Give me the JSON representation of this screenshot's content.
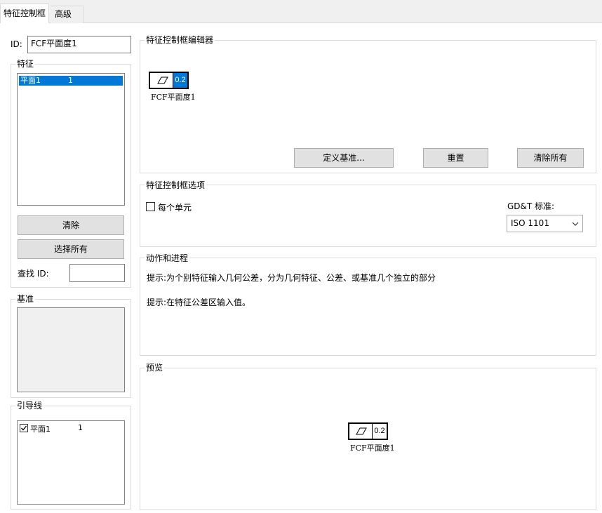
{
  "tabs": {
    "active": "特征控制框",
    "inactive": "高级"
  },
  "id_field": {
    "label": "ID:",
    "value": "FCF平面度1"
  },
  "features": {
    "group_label": "特征",
    "rows": [
      {
        "name": "平面1",
        "count": "1"
      }
    ],
    "clear_label": "清除",
    "select_all_label": "选择所有",
    "find_id_label": "查找 ID:",
    "find_id_value": ""
  },
  "datum": {
    "group_label": "基准"
  },
  "leader": {
    "group_label": "引导线",
    "rows": [
      {
        "name": "平面1",
        "count": "1",
        "checked": true
      }
    ]
  },
  "editor": {
    "group_label": "特征控制框编辑器",
    "tolerance": "0.2",
    "frame_label": "FCF平面度1",
    "define_datum_label": "定义基准...",
    "reset_label": "重置",
    "clear_all_label": "清除所有",
    "symbol_icon": "flatness-parallelogram-icon"
  },
  "options": {
    "group_label": "特征控制框选项",
    "per_unit_label": "每个单元",
    "per_unit_checked": false,
    "standard_label": "GD&T 标准:",
    "standard_value": "ISO 1101"
  },
  "actions": {
    "group_label": "动作和进程",
    "hint1": "提示:为个别特征输入几何公差，分为几何特征、公差、或基准几个独立的部分",
    "hint2": "提示:在特征公差区输入值。"
  },
  "preview": {
    "group_label": "预览",
    "tolerance": "0.2",
    "frame_label": "FCF平面度1"
  },
  "colors": {
    "selection": "#0078d7",
    "button_face": "#e1e1e1"
  }
}
